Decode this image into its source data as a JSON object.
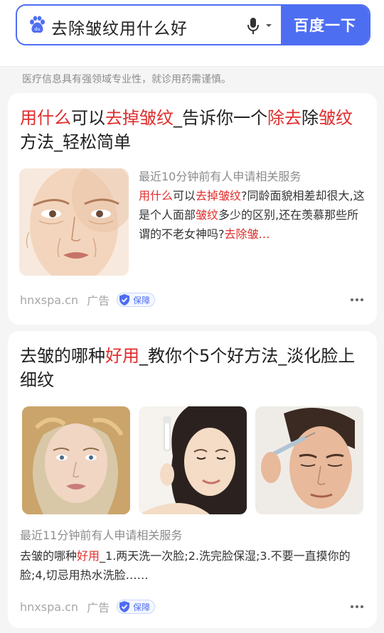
{
  "search": {
    "query": "去除皱纹用什么好",
    "button_label": "百度一下"
  },
  "notice": "医疗信息具有强领域专业性，就诊用药需谨慎。",
  "results": [
    {
      "title_parts": [
        {
          "text": "用什么",
          "hl": true
        },
        {
          "text": "可以",
          "hl": false
        },
        {
          "text": "去掉皱纹",
          "hl": true
        },
        {
          "text": "_告诉你一个",
          "hl": false
        },
        {
          "text": "除去",
          "hl": true
        },
        {
          "text": "除",
          "hl": false
        },
        {
          "text": "皱纹",
          "hl": true
        },
        {
          "text": "方法_轻松简单",
          "hl": false
        }
      ],
      "meta": "最近10分钟前有人申请相关服务",
      "desc_parts": [
        {
          "text": "用什么",
          "hl": true
        },
        {
          "text": "可以",
          "hl": false
        },
        {
          "text": "去掉皱纹",
          "hl": true
        },
        {
          "text": "?同龄面貌相差却很大,这是个人面部",
          "hl": false
        },
        {
          "text": "皱纹",
          "hl": true
        },
        {
          "text": "多少的区别,还在羡慕那些所谓的不老女神吗?",
          "hl": false
        },
        {
          "text": "去除皱…",
          "hl": true
        }
      ],
      "domain": "hnxspa.cn",
      "ad_label": "广告",
      "badge_label": "保障"
    },
    {
      "title_parts": [
        {
          "text": "去皱的哪种",
          "hl": false
        },
        {
          "text": "好用",
          "hl": true
        },
        {
          "text": "_教你个5个好方法_淡化脸上细纹",
          "hl": false
        }
      ],
      "meta": "最近11分钟前有人申请相关服务",
      "desc_parts": [
        {
          "text": "去皱的哪种",
          "hl": false
        },
        {
          "text": "好用",
          "hl": true
        },
        {
          "text": "_1.两天洗一次脸;2.洗完脸保湿;3.不要一直摸你的脸;4,切忌用热水洗脸……",
          "hl": false
        }
      ],
      "domain": "hnxspa.cn",
      "ad_label": "广告",
      "badge_label": "保障"
    }
  ],
  "colors": {
    "accent": "#4e6ef2",
    "highlight": "#e02d2d",
    "background": "#f5f5f6"
  }
}
